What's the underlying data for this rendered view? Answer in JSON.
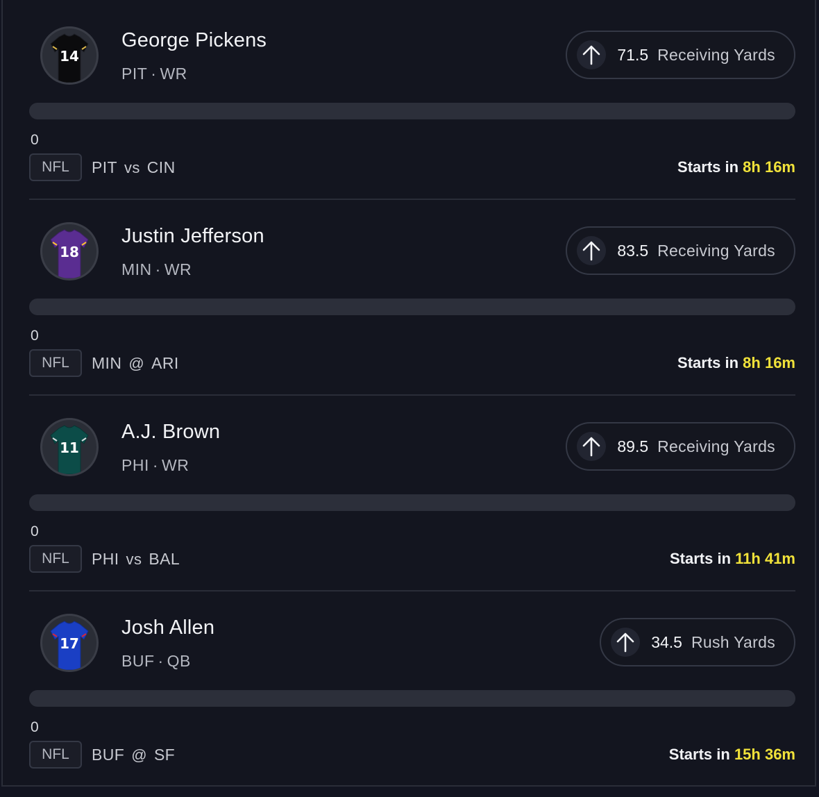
{
  "colors": {
    "background": "#13151f",
    "accent_yellow": "#f1e23a",
    "progress_track": "#2c2f3a"
  },
  "players": [
    {
      "name": "George Pickens",
      "team": "PIT",
      "position": "WR",
      "jersey_number": "14",
      "jersey_color": "#0b0b0d",
      "line": "71.5",
      "stat": "Receiving Yards",
      "direction_icon": "arrow-up-icon",
      "current_value": "0",
      "progress": 0,
      "league": "NFL",
      "home": "PIT",
      "separator": "vs",
      "away": "CIN",
      "starts_label": "Starts in",
      "starts_time": "8h 16m"
    },
    {
      "name": "Justin Jefferson",
      "team": "MIN",
      "position": "WR",
      "jersey_number": "18",
      "jersey_color": "#5a2d91",
      "line": "83.5",
      "stat": "Receiving Yards",
      "direction_icon": "arrow-up-icon",
      "current_value": "0",
      "progress": 0,
      "league": "NFL",
      "home": "MIN",
      "separator": "@",
      "away": "ARI",
      "starts_label": "Starts in",
      "starts_time": "8h 16m"
    },
    {
      "name": "A.J. Brown",
      "team": "PHI",
      "position": "WR",
      "jersey_number": "11",
      "jersey_color": "#0c4c48",
      "line": "89.5",
      "stat": "Receiving Yards",
      "direction_icon": "arrow-up-icon",
      "current_value": "0",
      "progress": 0,
      "league": "NFL",
      "home": "PHI",
      "separator": "vs",
      "away": "BAL",
      "starts_label": "Starts in",
      "starts_time": "11h 41m"
    },
    {
      "name": "Josh Allen",
      "team": "BUF",
      "position": "QB",
      "jersey_number": "17",
      "jersey_color": "#1a3fc4",
      "line": "34.5",
      "stat": "Rush Yards",
      "direction_icon": "arrow-up-icon",
      "current_value": "0",
      "progress": 0,
      "league": "NFL",
      "home": "BUF",
      "separator": "@",
      "away": "SF",
      "starts_label": "Starts in",
      "starts_time": "15h 36m"
    }
  ]
}
